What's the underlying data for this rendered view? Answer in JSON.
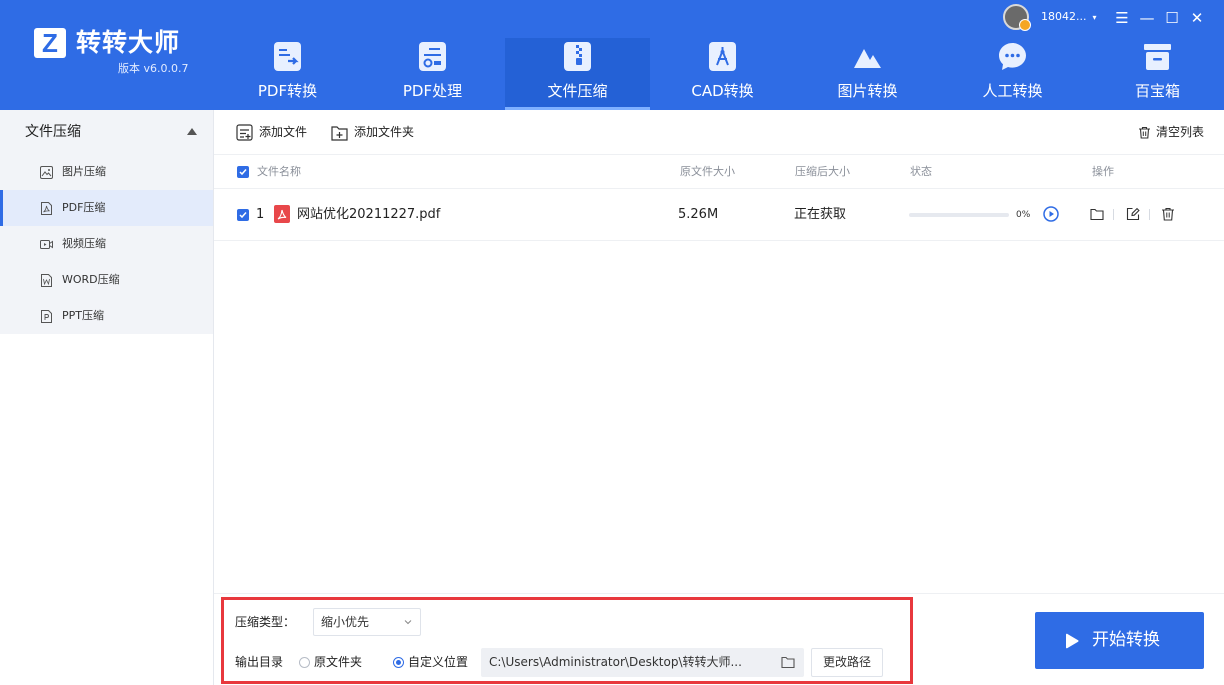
{
  "app": {
    "name": "转转大师",
    "version": "版本 v6.0.0.7",
    "logo_letter": "Z"
  },
  "nav": {
    "items": [
      {
        "label": "PDF转换",
        "icon": "pdf-convert-icon"
      },
      {
        "label": "PDF处理",
        "icon": "pdf-process-icon"
      },
      {
        "label": "文件压缩",
        "icon": "file-compress-icon",
        "active": true
      },
      {
        "label": "CAD转换",
        "icon": "cad-convert-icon"
      },
      {
        "label": "图片转换",
        "icon": "image-convert-icon"
      },
      {
        "label": "人工转换",
        "icon": "manual-convert-icon"
      },
      {
        "label": "百宝箱",
        "icon": "toolbox-icon"
      }
    ]
  },
  "user": {
    "name": "18042...",
    "caret": "▾"
  },
  "window_controls": {
    "menu": "☰",
    "minimize": "—",
    "maximize": "☐",
    "close": "✕"
  },
  "sidebar": {
    "header": "文件压缩",
    "items": [
      {
        "label": "图片压缩",
        "icon": "image-icon"
      },
      {
        "label": "PDF压缩",
        "icon": "pdf-file-icon",
        "active": true
      },
      {
        "label": "视频压缩",
        "icon": "video-icon"
      },
      {
        "label": "WORD压缩",
        "icon": "word-file-icon"
      },
      {
        "label": "PPT压缩",
        "icon": "ppt-file-icon"
      }
    ]
  },
  "toolbar": {
    "add_file": "添加文件",
    "add_folder": "添加文件夹",
    "clear_list": "清空列表"
  },
  "table": {
    "headers": {
      "name": "文件名称",
      "original_size": "原文件大小",
      "compressed_size": "压缩后大小",
      "status": "状态",
      "actions": "操作"
    },
    "rows": [
      {
        "index": "1",
        "file_name": "网站优化20211227.pdf",
        "original_size": "5.26M",
        "compressed_size": "正在获取",
        "progress_percent": 0,
        "progress_label": "0%"
      }
    ]
  },
  "settings": {
    "type_label": "压缩类型：",
    "type_value": "缩小优先",
    "output_label": "输出目录",
    "option_original": "原文件夹",
    "option_custom": "自定义位置",
    "selected_option": "custom",
    "path": "C:\\Users\\Administrator\\Desktop\\转转大师...",
    "change_path": "更改路径"
  },
  "start_button": "开始转换",
  "colors": {
    "brand": "#2f6ce5",
    "highlight_box": "#e8383d",
    "pdf_red": "#e8474a"
  }
}
